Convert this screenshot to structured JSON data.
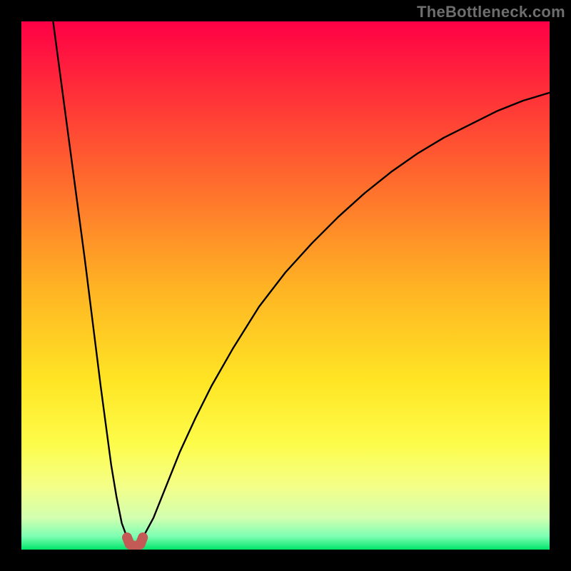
{
  "attribution": "TheBottleneck.com",
  "chart_data": {
    "type": "line",
    "title": "",
    "xlabel": "",
    "ylabel": "",
    "xlim": [
      0,
      100
    ],
    "ylim": [
      0,
      100
    ],
    "gradient_stops": [
      {
        "offset": 0.0,
        "color": "#ff0046"
      },
      {
        "offset": 0.12,
        "color": "#ff2a3a"
      },
      {
        "offset": 0.3,
        "color": "#ff6a2d"
      },
      {
        "offset": 0.5,
        "color": "#ffb224"
      },
      {
        "offset": 0.68,
        "color": "#ffe524"
      },
      {
        "offset": 0.8,
        "color": "#fdfc4a"
      },
      {
        "offset": 0.88,
        "color": "#f4ff88"
      },
      {
        "offset": 0.94,
        "color": "#d2ffb0"
      },
      {
        "offset": 0.975,
        "color": "#7dffb3"
      },
      {
        "offset": 1.0,
        "color": "#00e56a"
      }
    ],
    "series": [
      {
        "name": "left-branch",
        "x": [
          6.0,
          7.0,
          8.0,
          9.0,
          10.0,
          11.0,
          12.0,
          13.0,
          14.0,
          15.0,
          16.0,
          17.0,
          18.0,
          19.0,
          20.0
        ],
        "values": [
          100,
          92.5,
          85.0,
          77.5,
          70.0,
          62.5,
          55.0,
          47.0,
          39.0,
          31.0,
          23.5,
          16.0,
          10.0,
          5.0,
          2.3
        ]
      },
      {
        "name": "right-branch",
        "x": [
          23.0,
          25.0,
          27.0,
          30.0,
          33.0,
          36.0,
          40.0,
          45.0,
          50.0,
          55.0,
          60.0,
          65.0,
          70.0,
          75.0,
          80.0,
          85.0,
          90.0,
          95.0,
          100.0
        ],
        "values": [
          2.3,
          6.0,
          11.0,
          18.5,
          25.0,
          31.0,
          38.0,
          46.0,
          52.5,
          58.0,
          63.0,
          67.5,
          71.5,
          75.0,
          78.0,
          80.5,
          83.0,
          85.0,
          86.5
        ]
      }
    ],
    "trough_marker": {
      "x": [
        20.0,
        20.5,
        21.5,
        22.5,
        23.0
      ],
      "y": [
        2.3,
        1.0,
        0.6,
        1.0,
        2.3
      ],
      "color": "#c45a55",
      "width": 14
    }
  }
}
